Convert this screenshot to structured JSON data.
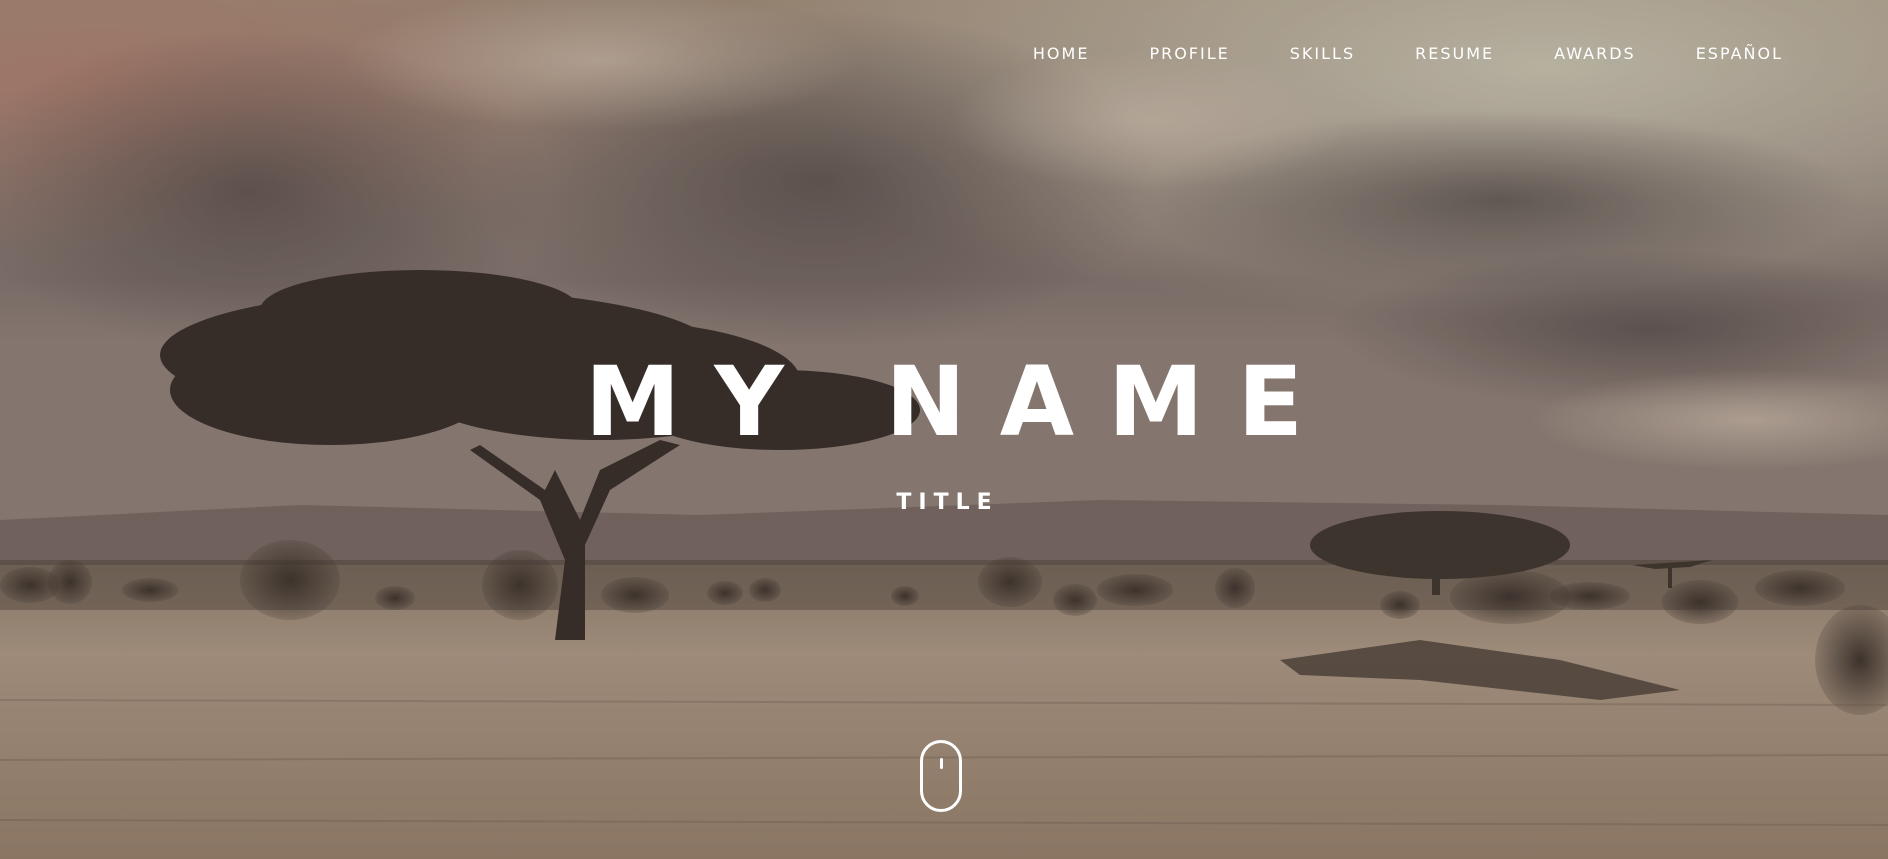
{
  "nav": {
    "items": [
      {
        "label": "HOME"
      },
      {
        "label": "PROFILE"
      },
      {
        "label": "SKILLS"
      },
      {
        "label": "RESUME"
      },
      {
        "label": "AWARDS"
      },
      {
        "label": "ESPAÑOL"
      }
    ]
  },
  "hero": {
    "name": "MY NAME",
    "title": "TITLE",
    "scroll_icon": "mouse-scroll-icon"
  },
  "colors": {
    "text": "#ffffff",
    "sky": "#8a7a70",
    "grass": "#a38f78"
  }
}
